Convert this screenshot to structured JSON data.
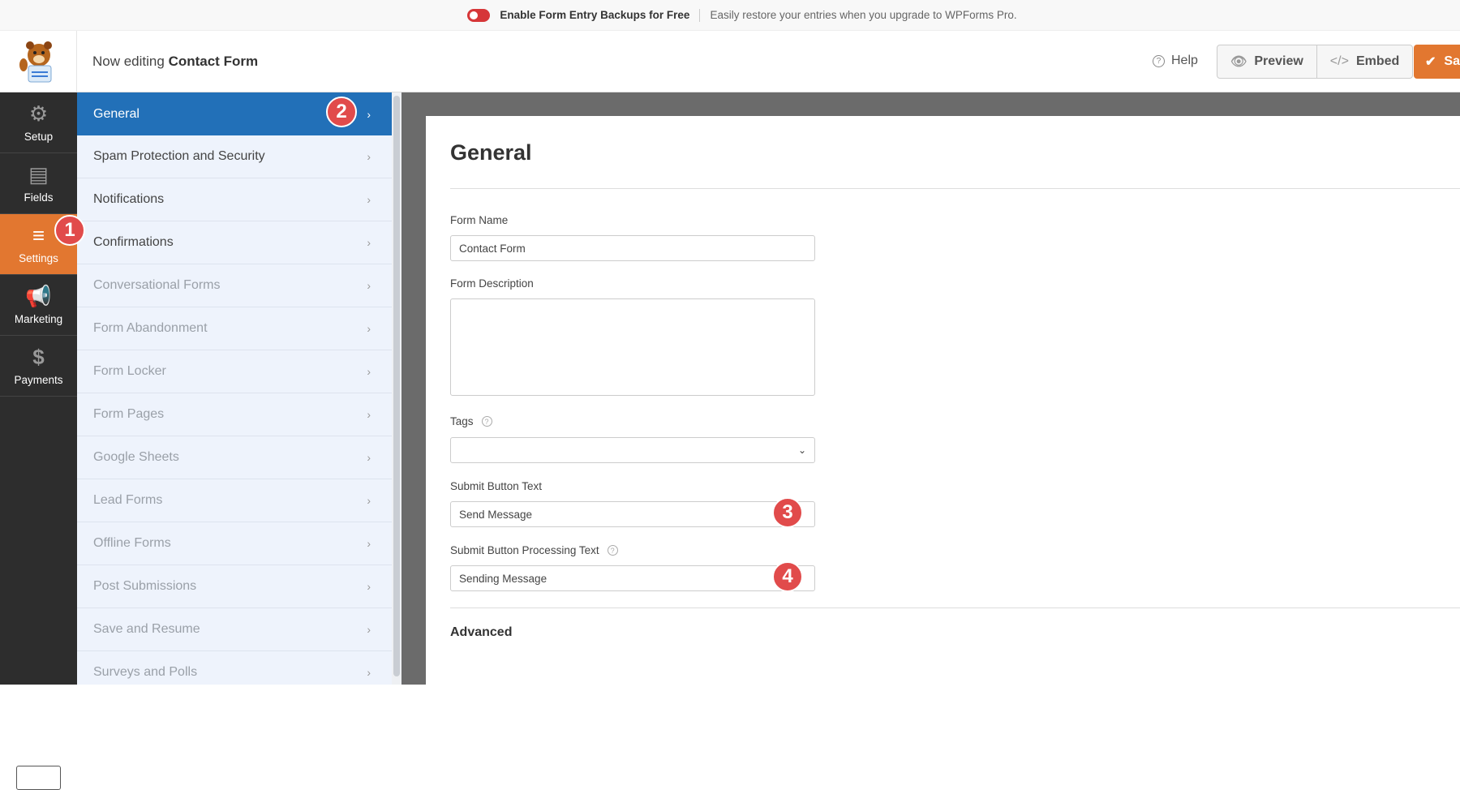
{
  "topbar": {
    "toggle_label": "Enable Form Entry Backups for Free",
    "subtext": "Easily restore your entries when you upgrade to WPForms Pro.",
    "toggle_color": "#d63638"
  },
  "header": {
    "prefix": "Now editing",
    "form_name": "Contact Form",
    "help": "Help",
    "preview": "Preview",
    "embed": "Embed",
    "save": "Save"
  },
  "leftnav": [
    {
      "label": "Setup",
      "icon": "gear-icon"
    },
    {
      "label": "Fields",
      "icon": "list-icon"
    },
    {
      "label": "Settings",
      "icon": "sliders-icon",
      "active": true
    },
    {
      "label": "Marketing",
      "icon": "megaphone-icon"
    },
    {
      "label": "Payments",
      "icon": "dollar-icon"
    }
  ],
  "panel": {
    "items": [
      "General",
      "Spam Protection and Security",
      "Notifications",
      "Confirmations",
      "Conversational Forms",
      "Form Abandonment",
      "Form Locker",
      "Form Pages",
      "Google Sheets",
      "Lead Forms",
      "Offline Forms",
      "Post Submissions",
      "Save and Resume",
      "Surveys and Polls"
    ]
  },
  "main": {
    "title": "General",
    "form_name_label": "Form Name",
    "form_name_value": "Contact Form",
    "description_label": "Form Description",
    "description_value": "",
    "tags_label": "Tags",
    "submit_label": "Submit Button Text",
    "submit_value": "Send Message",
    "processing_label": "Submit Button Processing Text",
    "processing_value": "Sending Message",
    "advanced": "Advanced"
  },
  "badges": [
    "1",
    "2",
    "3",
    "4"
  ],
  "colors": {
    "accent": "#e27730",
    "active_blue": "#2270b8",
    "badge": "#e14b4b"
  }
}
